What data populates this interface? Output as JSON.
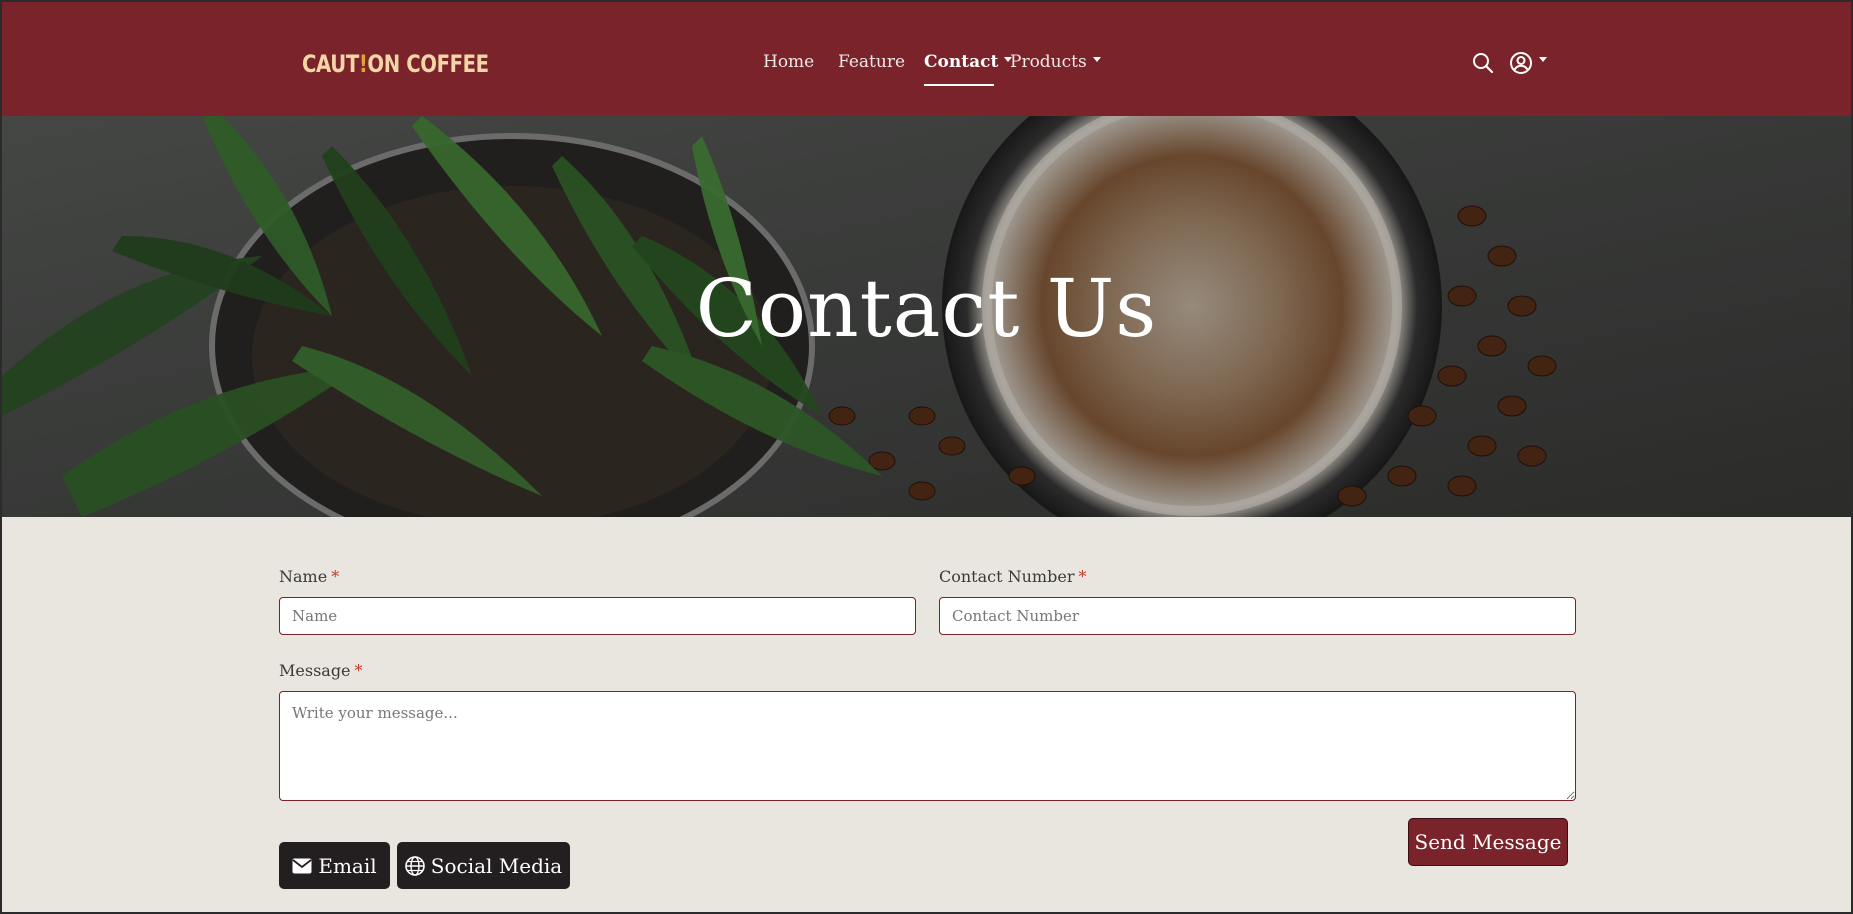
{
  "brand": {
    "logo_left": "CAUT",
    "logo_bang": "!",
    "logo_right": "ON COFFEE"
  },
  "nav": {
    "items": [
      {
        "label": "Home"
      },
      {
        "label": "Feature"
      },
      {
        "label": "Contact"
      },
      {
        "label": "Products"
      }
    ],
    "active": "Contact",
    "icons": [
      "search-icon",
      "user-circle-icon"
    ]
  },
  "hero": {
    "title": "Contact Us"
  },
  "form": {
    "name": {
      "label": "Name",
      "required_mark": "*",
      "placeholder": "Name"
    },
    "contact": {
      "label": "Contact Number",
      "required_mark": "*",
      "placeholder": "Contact Number"
    },
    "message": {
      "label": "Message",
      "required_mark": "*",
      "placeholder": "Write your message..."
    },
    "send_label": "Send Message",
    "email_label": "Email",
    "social_label": "Social Media"
  },
  "colors": {
    "brand": "#7a232a",
    "page_bg": "#e8e6df",
    "dark_button": "#231f20",
    "required": "#c0392b"
  }
}
